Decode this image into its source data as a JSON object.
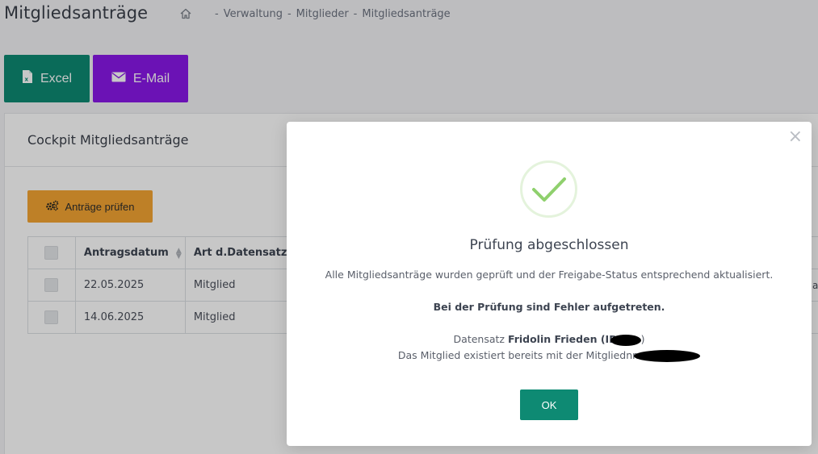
{
  "page": {
    "title": "Mitgliedsanträge",
    "breadcrumb": [
      "Verwaltung",
      "Mitglieder",
      "Mitgliedsanträge"
    ]
  },
  "toolbar": {
    "excel_label": "Excel",
    "email_label": "E-Mail"
  },
  "card": {
    "title": "Cockpit Mitgliedsanträge",
    "check_button": "Anträge prüfen"
  },
  "table": {
    "headers": [
      "Antragsdatum",
      "Art d.Datensatzes"
    ],
    "rows": [
      {
        "date": "22.05.2025",
        "art": "Mitglied"
      },
      {
        "date": "14.06.2025",
        "art": "Mitglied"
      }
    ],
    "edge_fragment": "a"
  },
  "modal": {
    "title": "Prüfung abgeschlossen",
    "message": "Alle Mitgliedsanträge wurden geprüft und der Freigabe-Status entsprechend aktualisiert.",
    "error_heading": "Bei der Prüfung sind Fehler aufgetreten.",
    "record_prefix": "Datensatz",
    "record_name": "Fridolin Frieden (ID:",
    "record_suffix": ")",
    "exists_text": "Das Mitglied existiert bereits mit der Mitgliednr.",
    "ok_label": "OK"
  },
  "colors": {
    "primary_teal": "#0e8a73",
    "purple": "#8a18e8",
    "orange": "#f4a533",
    "success_green": "#8fd06d"
  },
  "icons": {
    "home": "home-icon",
    "excel": "file-excel-icon",
    "mail": "envelope-icon",
    "gears": "cogs-icon",
    "check": "checkmark-icon",
    "close": "close-icon"
  }
}
